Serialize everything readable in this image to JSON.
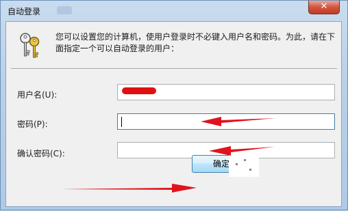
{
  "window": {
    "title": "自动登录",
    "close_label": "✕"
  },
  "intro_text": "您可以设置您的计算机，使用户登录时不必键入用户名和密码。为此，请在下面指定一个可以自动登录的用户：",
  "fields": {
    "username": {
      "label": "用户名(U):",
      "value": ""
    },
    "password": {
      "label": "密码(P):",
      "value": ""
    },
    "confirm_password": {
      "label": "确认密码(C):",
      "value": ""
    }
  },
  "buttons": {
    "ok_label": "确定"
  },
  "colors": {
    "annotation_arrow": "#e0141e",
    "title_bar": "#b9d0e8",
    "close_button": "#c23a22"
  },
  "icons": {
    "app": "keys-icon",
    "close": "close-icon"
  }
}
